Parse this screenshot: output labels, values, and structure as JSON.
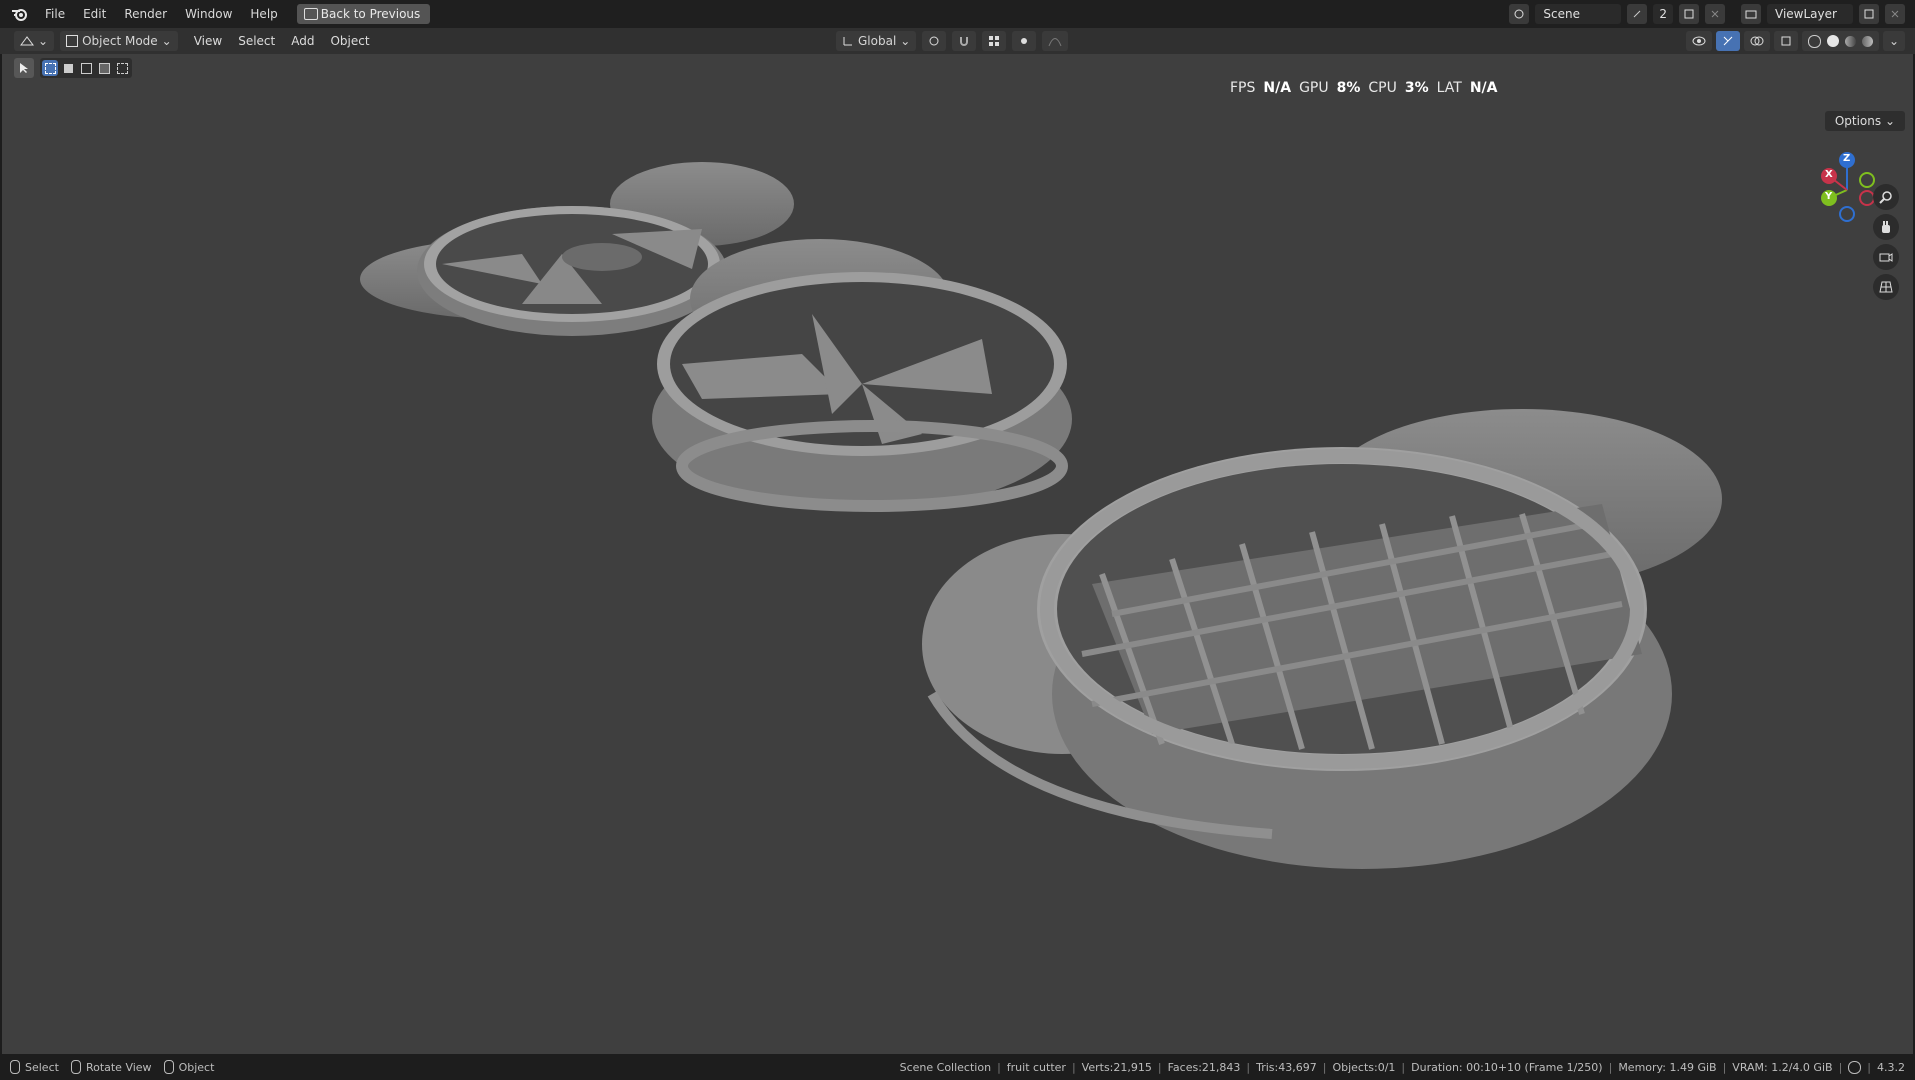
{
  "menu": {
    "items": [
      "File",
      "Edit",
      "Render",
      "Window",
      "Help"
    ],
    "back_label": "Back to Previous"
  },
  "top_right": {
    "scene": "Scene",
    "scene_users": "2",
    "view_layer": "ViewLayer"
  },
  "header": {
    "mode": "Object Mode",
    "menus": [
      "View",
      "Select",
      "Add",
      "Object"
    ],
    "orientation": "Global"
  },
  "stats": {
    "fps_label": "FPS",
    "fps_value": "N/A",
    "gpu_label": "GPU",
    "gpu_value": "8%",
    "cpu_label": "CPU",
    "cpu_value": "3%",
    "lat_label": "LAT",
    "lat_value": "N/A"
  },
  "options_label": "Options",
  "gizmo": {
    "x": "X",
    "y": "Y",
    "z": "Z"
  },
  "status": {
    "hints": [
      "Select",
      "Rotate View",
      "Object"
    ],
    "info": [
      "Scene Collection",
      "fruit cutter",
      "Verts:21,915",
      "Faces:21,843",
      "Tris:43,697",
      "Objects:0/1",
      "Duration: 00:10+10 (Frame 1/250)",
      "Memory: 1.49 GiB",
      "VRAM: 1.2/4.0 GiB"
    ],
    "version": "4.3.2"
  },
  "colors": {
    "viewport": "#3f3f3f",
    "header": "#303030",
    "topbar": "#1f1f1f",
    "accent": "#4772b3"
  }
}
